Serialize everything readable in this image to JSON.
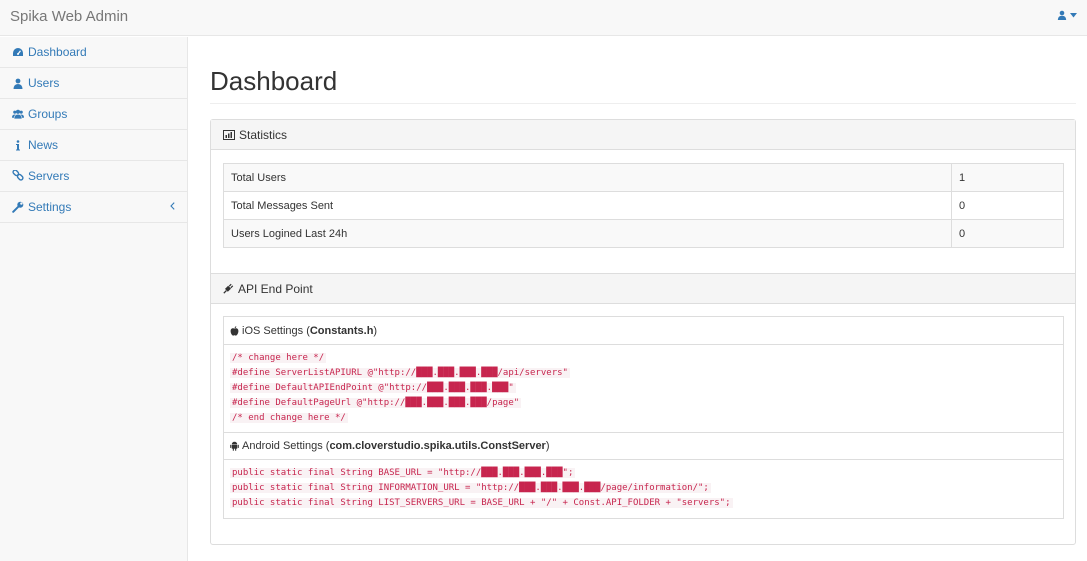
{
  "header": {
    "brand": "Spika Web Admin",
    "user_icon": "user-icon"
  },
  "sidebar": {
    "items": [
      {
        "label": "Dashboard",
        "icon": "dashboard-icon"
      },
      {
        "label": "Users",
        "icon": "user-icon"
      },
      {
        "label": "Groups",
        "icon": "users-icon"
      },
      {
        "label": "News",
        "icon": "info-icon"
      },
      {
        "label": "Servers",
        "icon": "link-icon"
      },
      {
        "label": "Settings",
        "icon": "wrench-icon"
      }
    ]
  },
  "main": {
    "title": "Dashboard",
    "statistics": {
      "heading": "Statistics",
      "rows": [
        {
          "label": "Total Users",
          "value": "1"
        },
        {
          "label": "Total Messages Sent",
          "value": "0"
        },
        {
          "label": "Users Logined Last 24h",
          "value": "0"
        }
      ]
    },
    "api": {
      "heading": "API End Point",
      "ios": {
        "label_prefix": "iOS Settings ( ",
        "file": "Constants.h",
        "label_suffix": " )",
        "lines": [
          "/* change here */",
          "#define ServerListAPIURL @\"http://███.███.███.███/api/servers\"",
          "#define DefaultAPIEndPoint @\"http://███.███.███.███\"",
          "#define DefaultPageUrl @\"http://███.███.███.███/page\"",
          "/* end change here */"
        ]
      },
      "android": {
        "label_prefix": "Android Settings ( ",
        "file": "com.cloverstudio.spika.utils.ConstServer",
        "label_suffix": " )",
        "lines": [
          "public static final String BASE_URL = \"http://███.███.███.███\";",
          "public static final String INFORMATION_URL = \"http://███.███.███.███/page/information/\";",
          "public static final String LIST_SERVERS_URL = BASE_URL + \"/\" + Const.API_FOLDER + \"servers\";"
        ]
      }
    }
  },
  "colors": {
    "link": "#337ab7",
    "code": "#c7254e",
    "code_bg": "#f9f2f4"
  }
}
